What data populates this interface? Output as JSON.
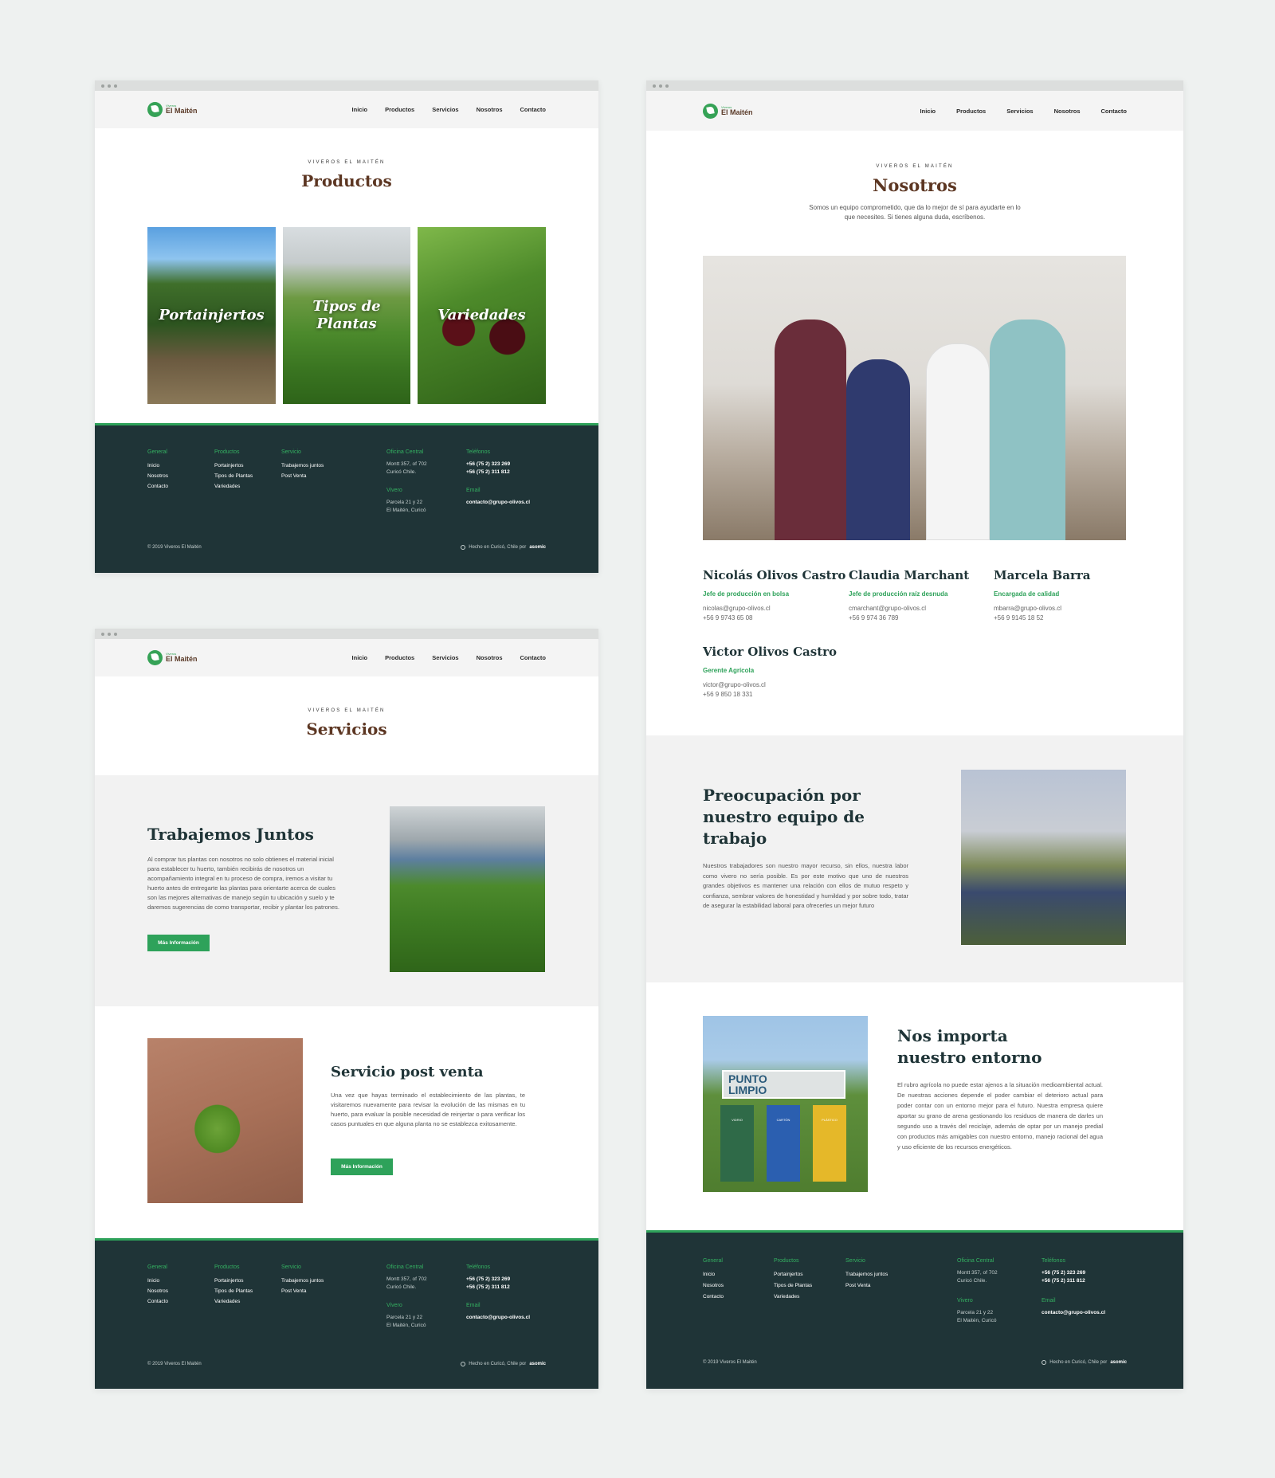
{
  "brand": {
    "small": "Viveros",
    "name": "El Maitén"
  },
  "nav": [
    "Inicio",
    "Productos",
    "Servicios",
    "Nosotros",
    "Contacto"
  ],
  "eyebrow": "VIVEROS EL MAITÉN",
  "productos": {
    "title": "Productos",
    "cards": [
      "Portainjertos",
      "Tipos de Plantas",
      "Variedades"
    ]
  },
  "servicios": {
    "title": "Servicios",
    "trabajemos": {
      "title": "Trabajemos Juntos",
      "text": "Al comprar tus plantas con nosotros no solo obtienes el material inicial para establecer tu huerto, también recibirás de nosotros un acompañamiento integral en tu proceso de compra, iremos a visitar tu huerto antes de entregarte las plantas para orientarte acerca de cuales son las mejores alternativas de manejo según tu ubicación y suelo y te daremos sugerencias de como transportar, recibir y plantar los patrones.",
      "button": "Más Información"
    },
    "postventa": {
      "title": "Servicio post venta",
      "text": "Una vez que hayas terminado el establecimiento de las plantas, te visitaremos nuevamente para revisar la evolución de las mismas en tu huerto, para evaluar la posible necesidad de reinjertar o para verificar los casos puntuales en que alguna planta no se establezca exitosamente.",
      "button": "Más Información"
    }
  },
  "nosotros": {
    "title": "Nosotros",
    "intro": "Somos un equipo comprometido, que da lo mejor de sí para ayudarte en lo que necesites. Si tienes alguna duda, escríbenos.",
    "team": [
      {
        "name": "Nicolás Olivos Castro",
        "role": "Jefe de producción en bolsa",
        "email": "nicolas@grupo-olivos.cl",
        "phone": "+56 9 9743 65 08"
      },
      {
        "name": "Claudia Marchant",
        "role": "Jefe de producción raíz desnuda",
        "email": "cmarchant@grupo-olivos.cl",
        "phone": "+56 9 974 36 789"
      },
      {
        "name": "Marcela Barra",
        "role": "Encargada de calidad",
        "email": "mbarra@grupo-olivos.cl",
        "phone": "+56 9 9145 18 52"
      },
      {
        "name": "Victor Olivos Castro",
        "role": "Gerente Agrícola",
        "email": "victor@grupo-olivos.cl",
        "phone": "+56 9 850 18 331"
      }
    ],
    "equipo": {
      "title": "Preocupación por nuestro equipo de trabajo",
      "text": "Nuestros trabajadores son nuestro mayor recurso, sin ellos, nuestra labor como vivero no sería posible. Es por este motivo que uno de nuestros grandes objetivos es mantener una relación con ellos de mutuo respeto y confianza, sembrar valores de honestidad y humildad y por sobre todo, tratar de asegurar la estabilidad laboral para ofrecerles un mejor futuro"
    },
    "entorno": {
      "title": "Nos importa nuestro entorno",
      "text": "El rubro agrícola no puede estar ajenos a la situación medioambiental actual. De nuestras acciones depende el poder cambiar el deterioro actual para poder contar con un entorno mejor para el futuro. Nuestra empresa quiere aportar su grano de arena gestionando los residuos de manera de darles un segundo uso a través del reciclaje, además de optar por un manejo predial con productos más amigables con nuestro entorno, manejo racional del agua y uso eficiente de los recursos energéticos.",
      "sign1": "PUNTO",
      "sign2": "LIMPIO",
      "bins": [
        "VIDRIO",
        "CARTÓN",
        "PLÁSTICO"
      ]
    }
  },
  "footer": {
    "general": {
      "head": "General",
      "links": [
        "Inicio",
        "Nosotros",
        "Contacto"
      ]
    },
    "productos": {
      "head": "Productos",
      "links": [
        "Portainjertos",
        "Tipos de Plantas",
        "Variedades"
      ]
    },
    "servicio": {
      "head": "Servicio",
      "links": [
        "Trabajemos juntos",
        "Post Venta"
      ]
    },
    "oficina": {
      "head": "Oficina Central",
      "line1": "Montt 357, of 702",
      "line2": "Curicó Chile."
    },
    "vivero": {
      "head": "Vivero",
      "line1": "Parcela 21 y 22",
      "line2": "El Maitén, Curicó"
    },
    "telefonos": {
      "head": "Teléfonos",
      "line1": "+56 (75 2) 323 269",
      "line2": "+56 (75 2) 311 812"
    },
    "email": {
      "head": "Email",
      "value": "contacto@grupo-olivos.cl"
    },
    "copy": "© 2019 Viveros El Maitén",
    "made": "Hecho en Curicó, Chile por",
    "made_by": "asomic"
  },
  "colors": {
    "green": "#2ea25a",
    "dark": "#1f3437",
    "brown": "#5c3622",
    "bg": "#eef1f0"
  }
}
